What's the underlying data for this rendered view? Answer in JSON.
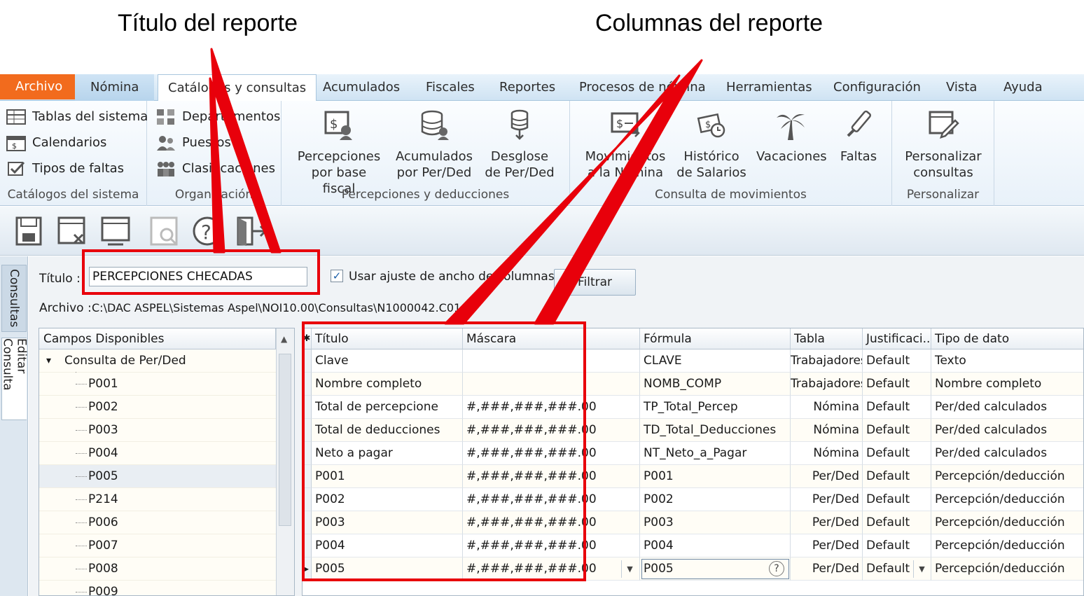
{
  "annotations": {
    "title_label": "Título del reporte",
    "columns_label": "Columnas del reporte"
  },
  "ribbon_tabs": [
    "Archivo",
    "Nómina",
    "Catálogos y consultas",
    "Acumulados",
    "Fiscales",
    "Reportes",
    "Procesos de nómina",
    "Herramientas",
    "Configuración",
    "Vista",
    "Ayuda"
  ],
  "groups": {
    "catalogos": {
      "label": "Catálogos del sistema",
      "items": [
        "Tablas del sistema",
        "Calendarios",
        "Tipos de faltas"
      ]
    },
    "organizacion": {
      "label": "Organización",
      "items": [
        "Departamentos",
        "Puestos",
        "Clasificaciones"
      ]
    },
    "percepciones": {
      "label": "Percepciones y deducciones",
      "items": [
        {
          "line1": "Percepciones",
          "line2": "por base fiscal"
        },
        {
          "line1": "Acumulados",
          "line2": "por Per/Ded"
        },
        {
          "line1": "Desglose",
          "line2": "de Per/Ded"
        }
      ]
    },
    "movimientos": {
      "label": "Consulta de movimientos",
      "items": [
        {
          "line1": "Movimientos",
          "line2": "a la Nómina"
        },
        {
          "line1": "Histórico",
          "line2": "de Salarios"
        },
        {
          "line1": "Vacaciones",
          "line2": ""
        },
        {
          "line1": "Faltas",
          "line2": ""
        }
      ]
    },
    "personalizar": {
      "label": "Personalizar",
      "items": [
        {
          "line1": "Personalizar",
          "line2": "consultas"
        }
      ]
    }
  },
  "side_tabs": [
    "Consultas",
    "Editar Consulta"
  ],
  "form": {
    "titulo_label": "Título :",
    "titulo_value": "PERCEPCIONES CHECADAS",
    "checkbox_label": "Usar ajuste de ancho de columnas",
    "checkbox_checked": true,
    "filtrar_label": "Filtrar",
    "archivo_label": "Archivo :",
    "archivo_value": "C:\\DAC ASPEL\\Sistemas Aspel\\NOI10.00\\Consultas\\N1000042.C01"
  },
  "tree": {
    "header": "Campos Disponibles",
    "root": "Consulta de Per/Ded",
    "items": [
      "P001",
      "P002",
      "P003",
      "P004",
      "P005",
      "P214",
      "P006",
      "P007",
      "P008",
      "P009"
    ],
    "selected": "P005"
  },
  "grid": {
    "columns": [
      "Título",
      "Máscara",
      "Fórmula",
      "Tabla",
      "Justificaci...",
      "Tipo de dato"
    ],
    "rows": [
      [
        "Clave",
        "",
        "CLAVE",
        "Trabajadores",
        "Default",
        "Texto"
      ],
      [
        "Nombre completo",
        "",
        "NOMB_COMP",
        "Trabajadores",
        "Default",
        "Nombre completo"
      ],
      [
        "Total de percepcione",
        "#,###,###,###.00",
        "TP_Total_Percep",
        "Nómina",
        "Default",
        "Per/ded calculados"
      ],
      [
        "Total de deducciones",
        "#,###,###,###.00",
        "TD_Total_Deducciones",
        "Nómina",
        "Default",
        "Per/ded calculados"
      ],
      [
        "Neto a pagar",
        "#,###,###,###.00",
        "NT_Neto_a_Pagar",
        "Nómina",
        "Default",
        "Per/ded calculados"
      ],
      [
        "P001",
        "#,###,###,###.00",
        "P001",
        "Per/Ded",
        "Default",
        "Percepción/deducción"
      ],
      [
        "P002",
        "#,###,###,###.00",
        "P002",
        "Per/Ded",
        "Default",
        "Percepción/deducción"
      ],
      [
        "P003",
        "#,###,###,###.00",
        "P003",
        "Per/Ded",
        "Default",
        "Percepción/deducción"
      ],
      [
        "P004",
        "#,###,###,###.00",
        "P004",
        "Per/Ded",
        "Default",
        "Percepción/deducción"
      ],
      [
        "P005",
        "#,###,###,###.00",
        "P005",
        "Per/Ded",
        "Default",
        "Percepción/deducción"
      ]
    ]
  },
  "colors": {
    "file_tab": "#f26b1d",
    "annotation_red": "#e8000b",
    "tab_bar": "#cfe3f3"
  }
}
